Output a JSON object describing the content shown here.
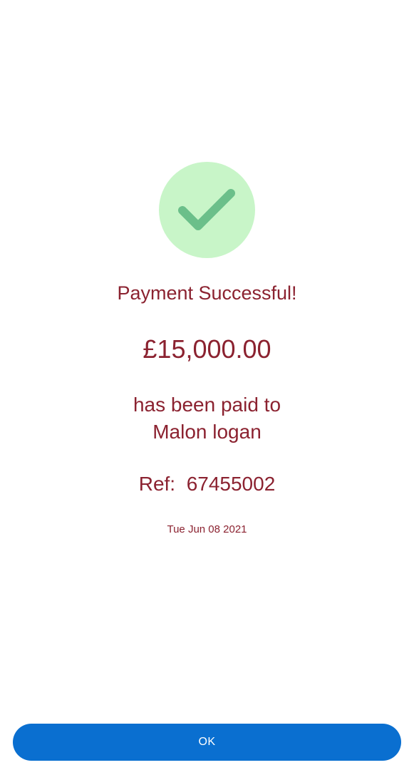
{
  "colors": {
    "text_primary": "#8b2230",
    "success_circle_bg": "#c8f5c8",
    "success_check": "#6bbf8a",
    "button_bg": "#0a6fd0",
    "button_text": "#ffffff",
    "background": "#ffffff"
  },
  "status": {
    "icon": "checkmark-icon",
    "title": "Payment Successful!"
  },
  "payment": {
    "amount": "£15,000.00",
    "paid_to_label": "has been paid to",
    "recipient": "Malon logan",
    "ref_label": "Ref:",
    "ref_number": "67455002",
    "date": "Tue Jun 08 2021"
  },
  "actions": {
    "ok_label": "OK"
  }
}
